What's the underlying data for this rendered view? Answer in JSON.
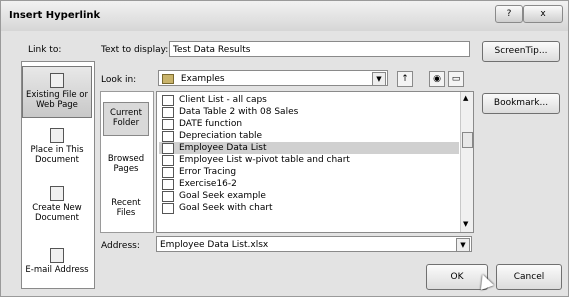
{
  "window": {
    "title": "Insert Hyperlink",
    "help_label": "?",
    "close_label": "x"
  },
  "link_to": {
    "label": "Link to:",
    "items": [
      {
        "label": "Existing File or Web Page"
      },
      {
        "label": "Place in This Document"
      },
      {
        "label": "Create New Document"
      },
      {
        "label": "E-mail Address"
      }
    ]
  },
  "text_to_display": {
    "label": "Text to display:",
    "value": "Test Data Results"
  },
  "screentip_label": "ScreenTip...",
  "look_in": {
    "label": "Look in:",
    "value": "Examples"
  },
  "locations": [
    {
      "label": "Current Folder"
    },
    {
      "label": "Browsed Pages"
    },
    {
      "label": "Recent Files"
    }
  ],
  "files": [
    "Client List - all caps",
    "Data Table 2 with 08 Sales",
    "DATE function",
    "Depreciation table",
    "Employee Data List",
    "Employee List w-pivot table and chart",
    "Error Tracing",
    "Exercise16-2",
    "Goal Seek example",
    "Goal Seek with chart"
  ],
  "selected_file_index": 4,
  "bookmark_label": "Bookmark...",
  "address": {
    "label": "Address:",
    "value": "Employee Data List.xlsx"
  },
  "ok_label": "OK",
  "cancel_label": "Cancel"
}
